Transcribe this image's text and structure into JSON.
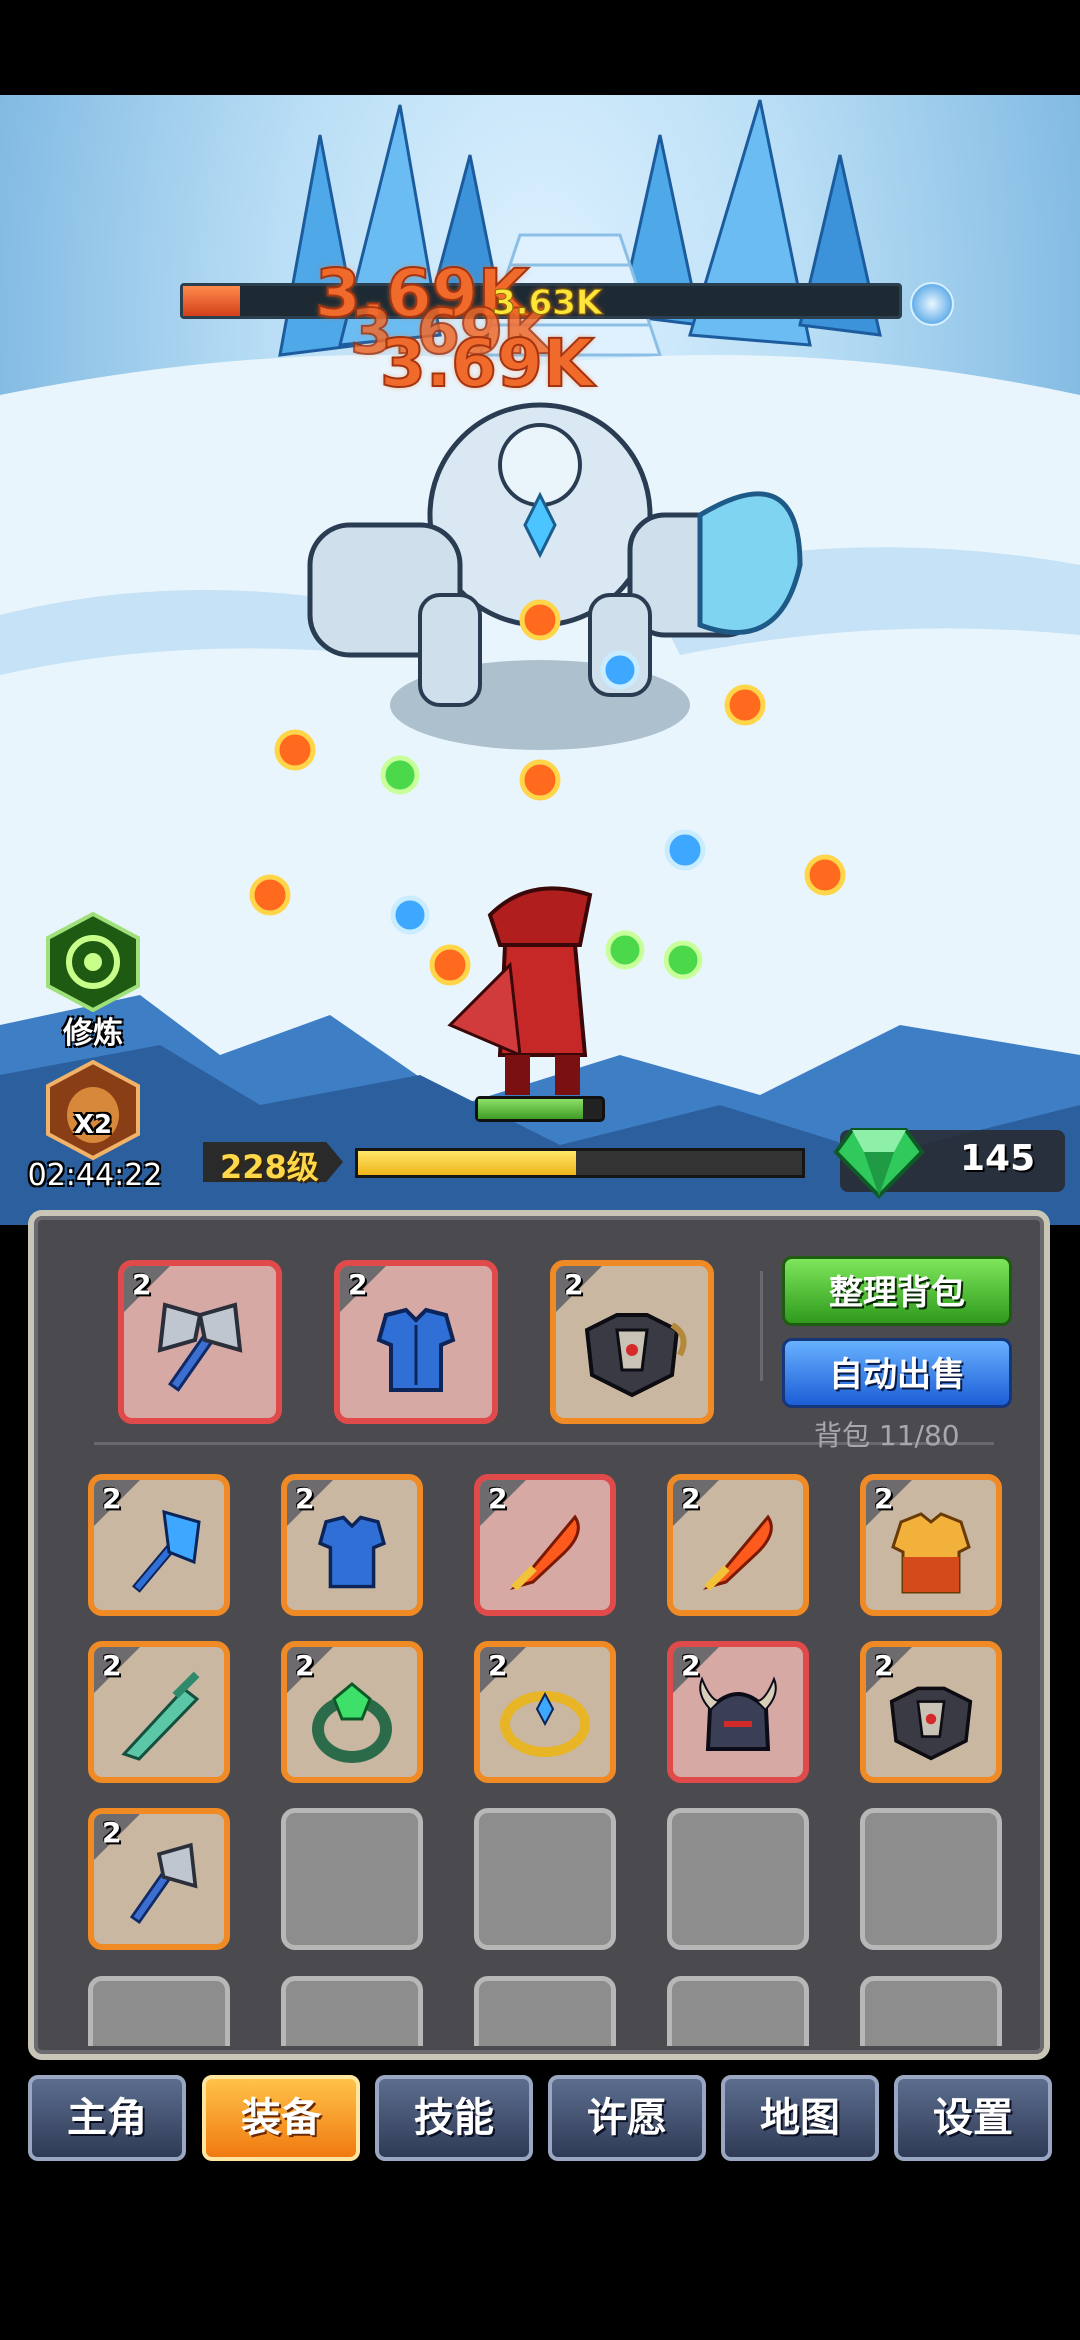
{
  "battle": {
    "boss_hp_fraction": 0.08,
    "damage_numbers": [
      "3.69K",
      "3.69K",
      "3.69K",
      "3.63K"
    ],
    "hero_hp_fraction": 0.85
  },
  "side": {
    "train_label": "修炼",
    "double_label": "X2",
    "timer": "02:44:22"
  },
  "status": {
    "level": "228级",
    "xp_fraction": 0.49,
    "gems": "145"
  },
  "inventory": {
    "sort_button": "整理背包",
    "auto_sell_button": "自动出售",
    "bag_count": "背包 11/80",
    "equipped": [
      {
        "level": "2",
        "item": "axe-icon",
        "rarity": "red"
      },
      {
        "level": "2",
        "item": "blue-armor-icon",
        "rarity": "red"
      },
      {
        "level": "2",
        "item": "dark-chest-armor-icon",
        "rarity": "orange"
      }
    ],
    "items": [
      {
        "level": "2",
        "item": "ice-mace-icon",
        "rarity": "orange"
      },
      {
        "level": "2",
        "item": "blue-armor-icon",
        "rarity": "orange"
      },
      {
        "level": "2",
        "item": "flame-sword-icon",
        "rarity": "red"
      },
      {
        "level": "2",
        "item": "flame-sword-icon",
        "rarity": "orange"
      },
      {
        "level": "2",
        "item": "gold-armor-icon",
        "rarity": "orange"
      },
      {
        "level": "2",
        "item": "jade-sword-icon",
        "rarity": "orange"
      },
      {
        "level": "2",
        "item": "emerald-ring-icon",
        "rarity": "orange"
      },
      {
        "level": "2",
        "item": "gold-crown-icon",
        "rarity": "orange"
      },
      {
        "level": "2",
        "item": "horned-helmet-icon",
        "rarity": "red"
      },
      {
        "level": "2",
        "item": "dark-chest-armor-icon",
        "rarity": "orange"
      },
      {
        "level": "2",
        "item": "axe-icon",
        "rarity": "orange"
      }
    ]
  },
  "nav": [
    "主角",
    "装备",
    "技能",
    "许愿",
    "地图",
    "设置"
  ],
  "colors": {
    "orange_rarity": "#f08a24",
    "red_rarity": "#e04a4a",
    "active_tab": "#f79a24"
  }
}
